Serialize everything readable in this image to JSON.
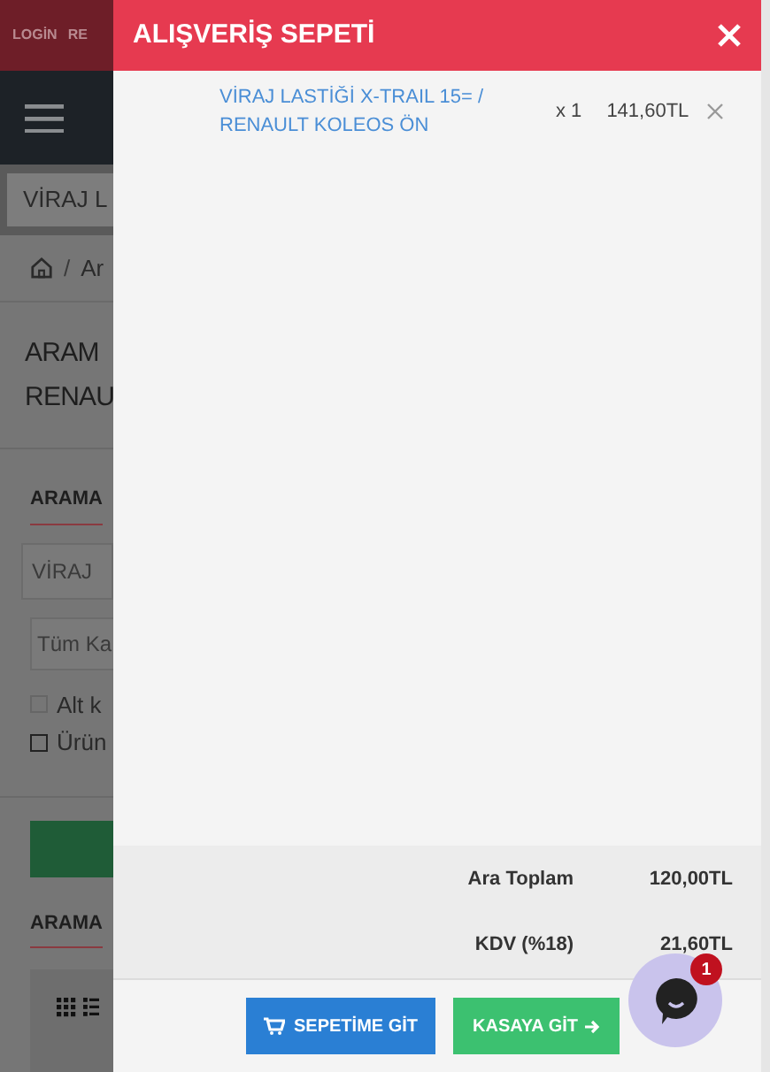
{
  "background_page": {
    "top_links": [
      "LOGİN",
      "RE"
    ],
    "search_value": "VİRAJ L",
    "breadcrumb_separator": "/",
    "breadcrumb": [
      "Ar"
    ],
    "title_lines": [
      "ARAM",
      "RENAU"
    ],
    "search_heading": "ARAMA",
    "search_field_value": "VİRAJ",
    "category_select": "Tüm Ka",
    "checkboxes": [
      {
        "label": "Alt k",
        "checked": false
      },
      {
        "label": "Ürün",
        "checked": false
      }
    ],
    "results_heading": "ARAMA"
  },
  "cart": {
    "title": "ALIŞVERİŞ SEPETİ",
    "items": [
      {
        "name": "VİRAJ LASTİĞİ X-TRAIL 15= / RENAULT KOLEOS ÖN",
        "quantity": "x 1",
        "price": "141,60TL"
      }
    ],
    "totals": [
      {
        "label": "Ara Toplam",
        "value": "120,00TL"
      },
      {
        "label": "KDV (%18)",
        "value": "21,60TL"
      }
    ],
    "buttons": [
      {
        "kind": "cart",
        "label": "SEPETİME GİT"
      },
      {
        "kind": "checkout",
        "label": "KASAYA GİT"
      }
    ]
  },
  "chat": {
    "badge": "1"
  }
}
